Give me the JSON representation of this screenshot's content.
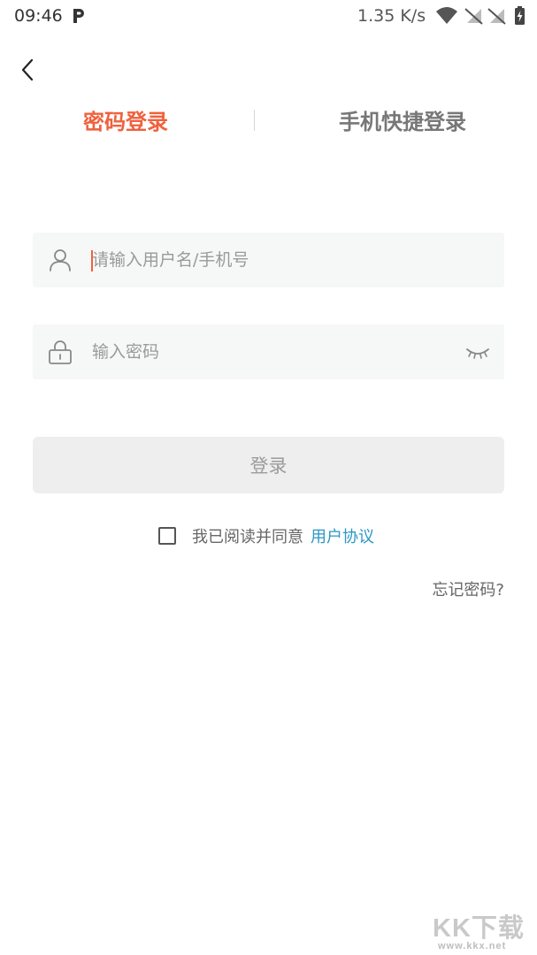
{
  "status_bar": {
    "time": "09:46",
    "speed": "1.35 K/s",
    "icons": [
      "p-icon",
      "wifi-icon",
      "no-sim-icon",
      "no-sim-icon",
      "battery-charging-icon"
    ]
  },
  "header": {
    "back_icon": "chevron-left-icon",
    "tabs": [
      {
        "label": "密码登录",
        "active": true
      },
      {
        "label": "手机快捷登录",
        "active": false
      }
    ]
  },
  "form": {
    "username": {
      "placeholder": "请输入用户名/手机号",
      "value": "",
      "icon": "user-icon"
    },
    "password": {
      "placeholder": "输入密码",
      "value": "",
      "icon": "lock-icon",
      "toggle_icon": "eye-closed-icon"
    },
    "login_label": "登录",
    "agree_text": "我已阅读并同意",
    "agree_link": "用户协议",
    "agree_checked": false,
    "forgot_label": "忘记密码?"
  },
  "watermark": {
    "text": "KK下载",
    "url": "www.kkx.net"
  },
  "colors": {
    "accent": "#f0613d",
    "link": "#2b97c4",
    "input_bg": "#f6f7f7",
    "button_bg": "#eeeeee"
  }
}
